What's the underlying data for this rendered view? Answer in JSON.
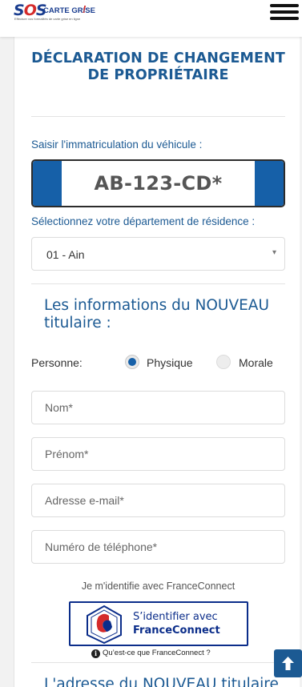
{
  "header": {
    "logo_sos": "SOS",
    "logo_brand": "CARTE GRISE",
    "logo_tagline": "Effectuer vos formalités de carte grise en ligne"
  },
  "form": {
    "title": "DÉCLARATION DE CHANGEMENT DE PROPRIÉTAIRE",
    "plate_label": "Saisir l'immatriculation du véhicule :",
    "plate_value": "AB-123-CD*",
    "department_label": "Sélectionnez votre département de résidence :",
    "department_selected": "01 - Ain"
  },
  "new_holder": {
    "title": "Les informations du NOUVEAU titulaire :",
    "personne_label": "Personne:",
    "options": [
      {
        "label": "Physique",
        "selected": true
      },
      {
        "label": "Morale",
        "selected": false
      }
    ],
    "fields": {
      "nom": "Nom*",
      "prenom": "Prénom*",
      "email": "Adresse e-mail*",
      "phone": "Numéro de téléphone*"
    }
  },
  "franceconnect": {
    "caption": "Je m'identifie avec FranceConnect",
    "button_line1": "S’identifier avec",
    "button_line2": "FranceConnect",
    "link": "Qu’est-ce que FranceConnect ?"
  },
  "next_section_title": "L'adresse du NOUVEAU titulaire",
  "colors": {
    "primary": "#1c5a93",
    "plate_band": "#1660a8",
    "franceconnect": "#0b2d8a"
  }
}
